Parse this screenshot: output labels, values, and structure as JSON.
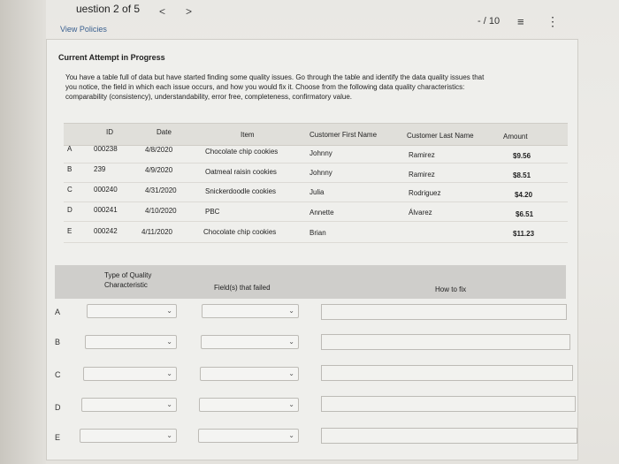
{
  "header": {
    "question_label": "uestion 2 of 5",
    "prev": "<",
    "next": ">",
    "score": "- / 10",
    "list_icon": "≡",
    "more_icon": "⋮"
  },
  "links": {
    "view_policies": "View Policies"
  },
  "attempt": {
    "status": "Current Attempt in Progress"
  },
  "instructions": {
    "line1": "You have a table full of data but have started finding some quality issues. Go through the table and identify the data quality issues that",
    "line2": "you notice, the field in which each issue occurs, and how you would fix it. Choose from the following data quality characteristics:",
    "line3": "comparability (consistency), understandability, error free, completeness, confirmatory value."
  },
  "data_table": {
    "headers": [
      "ID",
      "Date",
      "Item",
      "Customer First Name",
      "Customer Last Name",
      "Amount"
    ],
    "rows": [
      {
        "label": "A",
        "id": "000238",
        "date": "4/8/2020",
        "item": "Chocolate chip cookies",
        "first": "Johnny",
        "last": "Ramirez",
        "amount": "$9.56"
      },
      {
        "label": "B",
        "id": "239",
        "date": "4/9/2020",
        "item": "Oatmeal raisin cookies",
        "first": "Johnny",
        "last": "Ramirez",
        "amount": "$8.51"
      },
      {
        "label": "C",
        "id": "000240",
        "date": "4/31/2020",
        "item": "Snickerdoodle cookies",
        "first": "Julia",
        "last": "Rodriguez",
        "amount": "$4.20"
      },
      {
        "label": "D",
        "id": "000241",
        "date": "4/10/2020",
        "item": "PBC",
        "first": "Annette",
        "last": "Álvarez",
        "amount": "$6.51"
      },
      {
        "label": "E",
        "id": "000242",
        "date": "4/11/2020",
        "item": "Chocolate chip cookies",
        "first": "Brian",
        "last": "",
        "amount": "$11.23"
      }
    ]
  },
  "answer_table": {
    "headers": {
      "type": "Type of Quality Characteristic",
      "fields": "Field(s) that failed",
      "fix": "How to fix"
    },
    "rows": [
      "A",
      "B",
      "C",
      "D",
      "E"
    ]
  }
}
